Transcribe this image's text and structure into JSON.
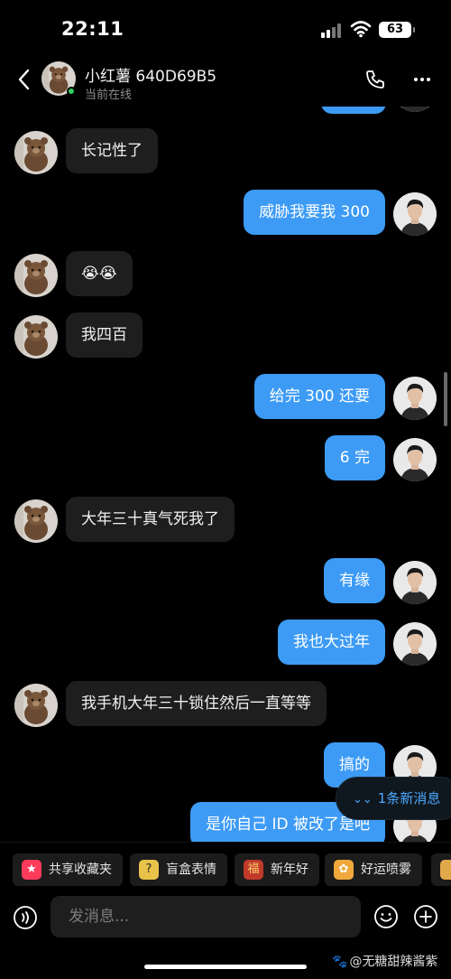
{
  "status_bar": {
    "time": "22:11",
    "battery": "63"
  },
  "header": {
    "name": "小红薯 640D69B5",
    "status": "当前在线"
  },
  "messages": [
    {
      "dir": "in",
      "text": "长记性了"
    },
    {
      "dir": "out",
      "text": "威胁我要我 300"
    },
    {
      "dir": "in",
      "text": "😭😭"
    },
    {
      "dir": "in",
      "text": "我四百"
    },
    {
      "dir": "out",
      "text": "给完 300 还要"
    },
    {
      "dir": "out",
      "text": "6 完"
    },
    {
      "dir": "in",
      "text": "大年三十真气死我了"
    },
    {
      "dir": "out",
      "text": "有缘"
    },
    {
      "dir": "out",
      "text": "我也大过年"
    },
    {
      "dir": "in",
      "text": "我手机大年三十锁住然后一直等等"
    },
    {
      "dir": "out",
      "text": "搞的"
    },
    {
      "dir": "out",
      "text": "是你自己 ID 被改了是吧"
    }
  ],
  "new_messages": {
    "label": "1条新消息"
  },
  "quick_actions": [
    {
      "label": "共享收藏夹",
      "icon": "bookmark-icon",
      "color": "#ff3b5c"
    },
    {
      "label": "盲盒表情",
      "icon": "question-box-icon",
      "color": "#e9c24a"
    },
    {
      "label": "新年好",
      "icon": "new-year-icon",
      "color": "#c0392b"
    },
    {
      "label": "好运喷雾",
      "icon": "lucky-spray-icon",
      "color": "#f0a83c"
    }
  ],
  "input": {
    "placeholder": "发消息..."
  },
  "watermark": "@无糖甜辣酱紫",
  "colors": {
    "accent": "#3d9bf5",
    "incoming": "#1e1e1e",
    "online": "#2ecf5f"
  }
}
